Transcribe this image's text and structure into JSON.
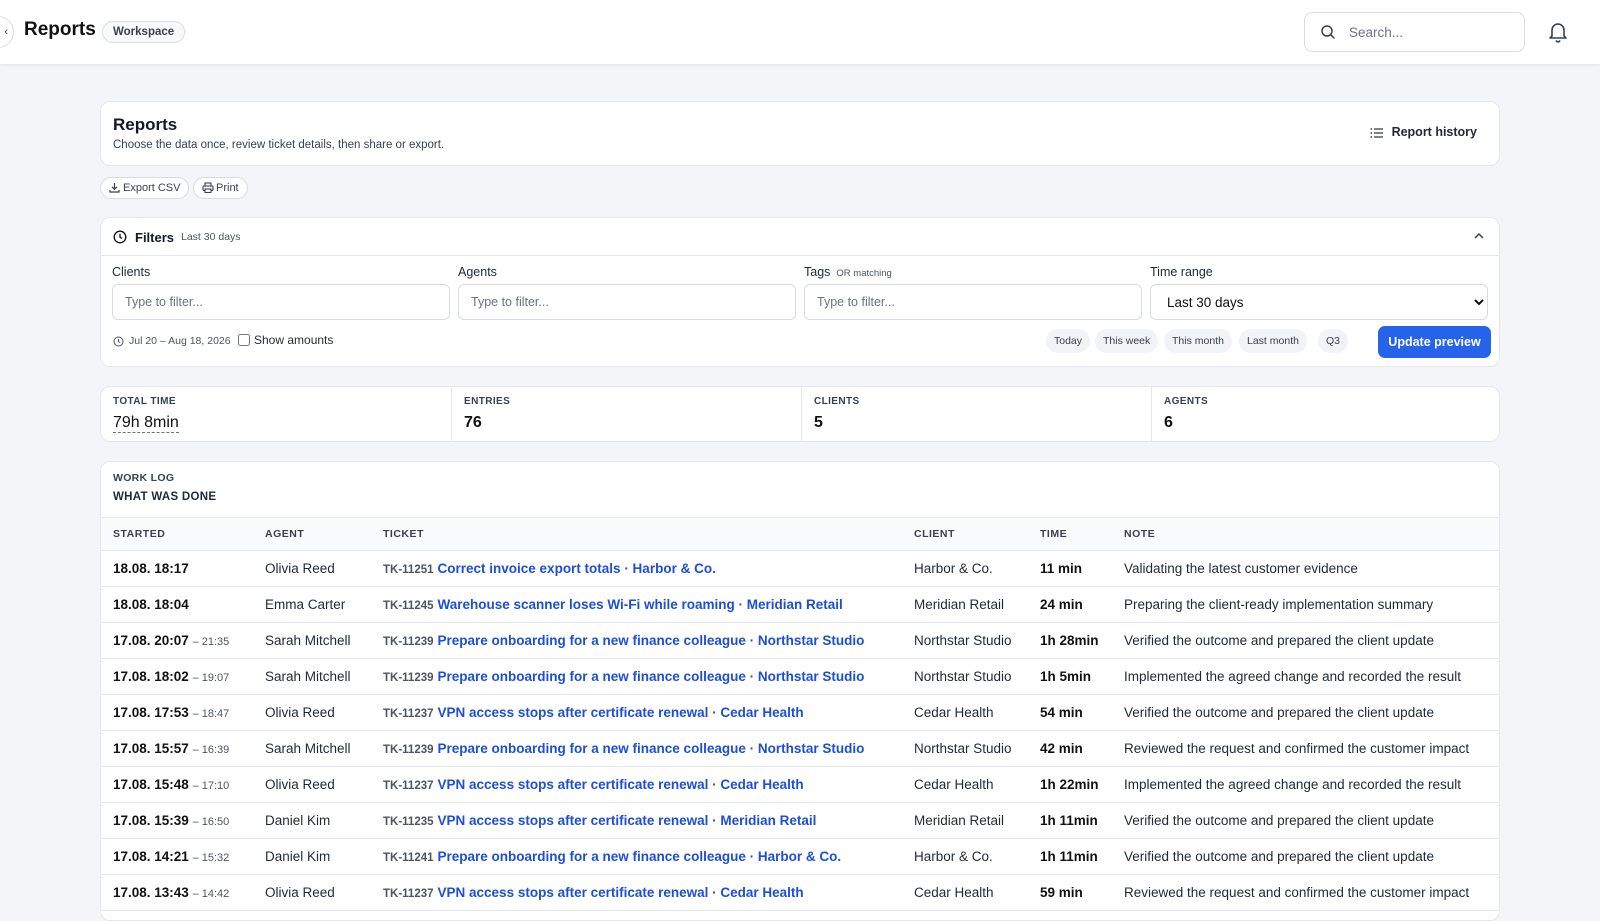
{
  "topbar": {
    "back_icon": "chevron-left-icon",
    "title": "Reports",
    "workspace_badge": "Workspace",
    "search_placeholder": "Search...",
    "notification_icon": "bell-icon"
  },
  "header": {
    "title": "Reports",
    "subtitle": "Choose the data once, review ticket details, then share or export.",
    "history_button": "Report history"
  },
  "actions": {
    "export_csv": "Export CSV",
    "print": "Print"
  },
  "filters": {
    "title": "Filters",
    "active_range": "Last 30 days",
    "clients_label": "Clients",
    "clients_placeholder": "Type to filter...",
    "agents_label": "Agents",
    "agents_placeholder": "Type to filter...",
    "tags_label": "Tags",
    "tags_sub": "OR matching",
    "tags_placeholder": "Type to filter...",
    "time_range_label": "Time range",
    "time_range_value": "Last 30 days",
    "date_range": "Jul 20 – Aug 18, 2026",
    "show_amounts": "Show amounts",
    "quick_ranges": [
      "Today",
      "This week",
      "This month",
      "Last month",
      "Q3"
    ],
    "update_button": "Update preview"
  },
  "stats": [
    {
      "label": "TOTAL TIME",
      "value": "79h 8min"
    },
    {
      "label": "ENTRIES",
      "value": "76"
    },
    {
      "label": "CLIENTS",
      "value": "5"
    },
    {
      "label": "AGENTS",
      "value": "6"
    }
  ],
  "work_log": {
    "kicker": "WORK LOG",
    "title": "WHAT WAS DONE",
    "columns": [
      "STARTED",
      "AGENT",
      "TICKET",
      "CLIENT",
      "TIME",
      "NOTE"
    ],
    "rows": [
      {
        "started": "18.08. 18:17",
        "end": "",
        "agent": "Olivia Reed",
        "ticket_id": "TK-11251",
        "ticket": "Correct invoice export totals · Harbor & Co.",
        "client": "Harbor & Co.",
        "time": "11 min",
        "note": "Validating the latest customer evidence"
      },
      {
        "started": "18.08. 18:04",
        "end": "",
        "agent": "Emma Carter",
        "ticket_id": "TK-11245",
        "ticket": "Warehouse scanner loses Wi-Fi while roaming · Meridian Retail",
        "client": "Meridian Retail",
        "time": "24 min",
        "note": "Preparing the client-ready implementation summary"
      },
      {
        "started": "17.08. 20:07",
        "end": "– 21:35",
        "agent": "Sarah Mitchell",
        "ticket_id": "TK-11239",
        "ticket": "Prepare onboarding for a new finance colleague · Northstar Studio",
        "client": "Northstar Studio",
        "time": "1h 28min",
        "note": "Verified the outcome and prepared the client update"
      },
      {
        "started": "17.08. 18:02",
        "end": "– 19:07",
        "agent": "Sarah Mitchell",
        "ticket_id": "TK-11239",
        "ticket": "Prepare onboarding for a new finance colleague · Northstar Studio",
        "client": "Northstar Studio",
        "time": "1h 5min",
        "note": "Implemented the agreed change and recorded the result"
      },
      {
        "started": "17.08. 17:53",
        "end": "– 18:47",
        "agent": "Olivia Reed",
        "ticket_id": "TK-11237",
        "ticket": "VPN access stops after certificate renewal · Cedar Health",
        "client": "Cedar Health",
        "time": "54 min",
        "note": "Verified the outcome and prepared the client update"
      },
      {
        "started": "17.08. 15:57",
        "end": "– 16:39",
        "agent": "Sarah Mitchell",
        "ticket_id": "TK-11239",
        "ticket": "Prepare onboarding for a new finance colleague · Northstar Studio",
        "client": "Northstar Studio",
        "time": "42 min",
        "note": "Reviewed the request and confirmed the customer impact"
      },
      {
        "started": "17.08. 15:48",
        "end": "– 17:10",
        "agent": "Olivia Reed",
        "ticket_id": "TK-11237",
        "ticket": "VPN access stops after certificate renewal · Cedar Health",
        "client": "Cedar Health",
        "time": "1h 22min",
        "note": "Implemented the agreed change and recorded the result"
      },
      {
        "started": "17.08. 15:39",
        "end": "– 16:50",
        "agent": "Daniel Kim",
        "ticket_id": "TK-11235",
        "ticket": "VPN access stops after certificate renewal · Meridian Retail",
        "client": "Meridian Retail",
        "time": "1h 11min",
        "note": "Verified the outcome and prepared the client update"
      },
      {
        "started": "17.08. 14:21",
        "end": "– 15:32",
        "agent": "Daniel Kim",
        "ticket_id": "TK-11241",
        "ticket": "Prepare onboarding for a new finance colleague · Harbor & Co.",
        "client": "Harbor & Co.",
        "time": "1h 11min",
        "note": "Verified the outcome and prepared the client update"
      },
      {
        "started": "17.08. 13:43",
        "end": "– 14:42",
        "agent": "Olivia Reed",
        "ticket_id": "TK-11237",
        "ticket": "VPN access stops after certificate renewal · Cedar Health",
        "client": "Cedar Health",
        "time": "59 min",
        "note": "Reviewed the request and confirmed the customer impact"
      }
    ]
  },
  "colors": {
    "accent": "#2563eb",
    "link": "#1d4ed8",
    "background": "#f3f5f9"
  }
}
